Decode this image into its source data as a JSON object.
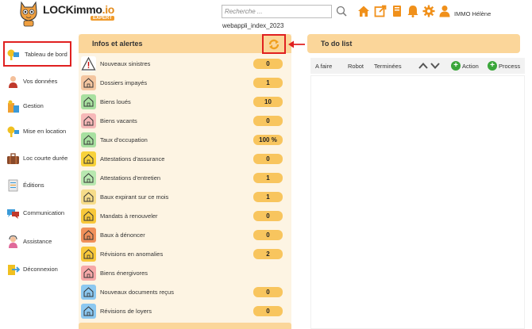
{
  "header": {
    "brand_main": "LOCKimmo",
    "brand_suffix": ".io",
    "brand_badge": "EXPERT",
    "search_placeholder": "Recherche ...",
    "subtitle": "webappli_index_2023",
    "toolbar_icons": [
      "home-icon",
      "external-link-icon",
      "book-icon",
      "bell-icon",
      "gear-icon",
      "user-icon"
    ],
    "username": "IMMO Hélène"
  },
  "sidebar": {
    "items": [
      {
        "label": "Tableau de bord",
        "icon": "dashboard-icon",
        "active": true
      },
      {
        "label": "Vos données",
        "icon": "person-icon"
      },
      {
        "label": "Gestion",
        "icon": "building-icon"
      },
      {
        "label": "Mise en location",
        "icon": "key-icon"
      },
      {
        "label": "Loc courte durée",
        "icon": "suitcase-icon"
      },
      {
        "label": "Éditions",
        "icon": "document-icon"
      },
      {
        "label": "Communication",
        "icon": "chat-icon"
      },
      {
        "label": "Assistance",
        "icon": "support-icon"
      },
      {
        "label": "Déconnexion",
        "icon": "logout-icon"
      }
    ]
  },
  "infos": {
    "title": "Infos et alertes",
    "refresh_icon": "refresh-icon",
    "rows": [
      {
        "label": "Nouveaux sinistres",
        "value": "0",
        "color": "#ffffff"
      },
      {
        "label": "Dossiers impayés",
        "value": "1",
        "color": "#f4c6a0"
      },
      {
        "label": "Biens loués",
        "value": "10",
        "color": "#a8e0a0"
      },
      {
        "label": "Biens vacants",
        "value": "0",
        "color": "#f6b8b8"
      },
      {
        "label": "Taux d'occupation",
        "value": "100 %",
        "color": "#a8e0a0"
      },
      {
        "label": "Attestations d'assurance",
        "value": "0",
        "color": "#f8d23a"
      },
      {
        "label": "Attestations d'entretien",
        "value": "1",
        "color": "#b8e8b0"
      },
      {
        "label": "Baux expirant sur ce mois",
        "value": "1",
        "color": "#f6dc8a"
      },
      {
        "label": "Mandats à renouveler",
        "value": "0",
        "color": "#f8c83a"
      },
      {
        "label": "Baux à dénoncer",
        "value": "0",
        "color": "#f0905a"
      },
      {
        "label": "Révisions en anomalies",
        "value": "2",
        "color": "#f8c83a"
      },
      {
        "label": "Biens énergivores",
        "value": "",
        "color": "#f6a8a8"
      },
      {
        "label": "Nouveaux documents reçus",
        "value": "0",
        "color": "#8cc8f0"
      },
      {
        "label": "Révisions de loyers",
        "value": "0",
        "color": "#8cc8f0"
      }
    ]
  },
  "todo": {
    "title": "To do list",
    "tabs": [
      "A faire",
      "Robot",
      "Terminées"
    ],
    "action_label": "Action",
    "process_label": "Process"
  }
}
